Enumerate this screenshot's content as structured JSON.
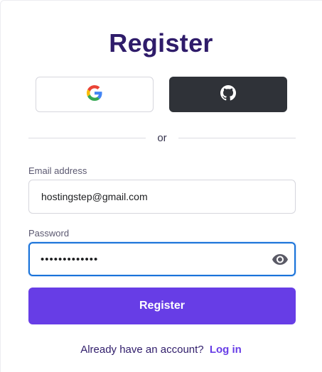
{
  "page": {
    "title": "Register"
  },
  "social": {
    "google_icon": "google-logo",
    "github_icon": "github-logo",
    "github_bg": "#2f3238"
  },
  "divider": {
    "text": "or"
  },
  "email": {
    "label": "Email address",
    "value": "hostingstep@gmail.com"
  },
  "password": {
    "label": "Password",
    "value": "•••••••••••••",
    "toggle_icon": "eye-icon"
  },
  "register_button": {
    "label": "Register",
    "color": "#673de6"
  },
  "footer": {
    "prompt": "Already have an account?",
    "link": "Log in"
  }
}
